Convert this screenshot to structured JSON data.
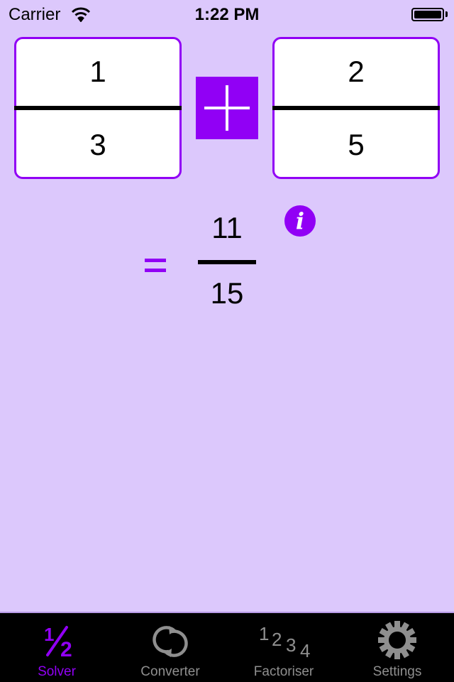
{
  "status_bar": {
    "carrier": "Carrier",
    "time": "1:22 PM",
    "wifi_icon": "wifi-icon",
    "battery_icon": "battery-icon",
    "battery_level": 1.0
  },
  "solver": {
    "fraction_a": {
      "numerator": "1",
      "denominator": "3"
    },
    "operator": {
      "symbol": "+",
      "icon": "plus-icon"
    },
    "fraction_b": {
      "numerator": "2",
      "denominator": "5"
    },
    "equals_symbol": "=",
    "result": {
      "numerator": "11",
      "denominator": "15"
    },
    "info_button": {
      "label": "i",
      "icon": "info-icon"
    }
  },
  "colors": {
    "accent": "#9100f5",
    "background": "#dcc8fc",
    "tab_bar_background": "#000000",
    "tab_inactive": "#8f8f8f"
  },
  "tab_bar": {
    "active_index": 0,
    "tabs": [
      {
        "label": "Solver",
        "icon": "half-fraction-icon",
        "glyph_top": "1",
        "glyph_bottom": "2"
      },
      {
        "label": "Converter",
        "icon": "converter-icon"
      },
      {
        "label": "Factoriser",
        "icon": "factoriser-icon",
        "glyphs": [
          "1",
          "2",
          "3",
          "4"
        ]
      },
      {
        "label": "Settings",
        "icon": "gear-icon"
      }
    ]
  }
}
